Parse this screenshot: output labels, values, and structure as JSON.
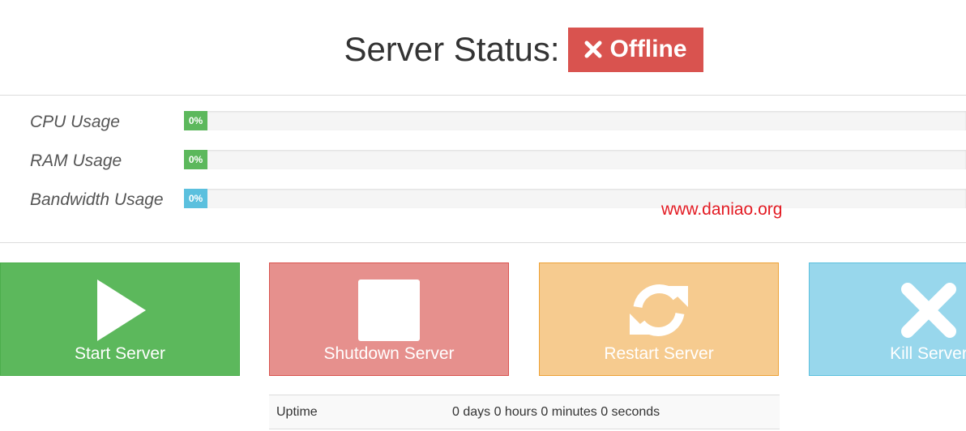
{
  "header": {
    "title": "Server Status:",
    "status_label": "Offline",
    "status_color": "#d9534f",
    "status_icon": "x-icon"
  },
  "usage": [
    {
      "label": "CPU Usage",
      "percent": 0,
      "percent_text": "0%",
      "color": "#5cb85c"
    },
    {
      "label": "RAM Usage",
      "percent": 0,
      "percent_text": "0%",
      "color": "#5cb85c"
    },
    {
      "label": "Bandwidth Usage",
      "percent": 0,
      "percent_text": "0%",
      "color": "#5bc0de"
    }
  ],
  "watermark": "www.daniao.org",
  "actions": [
    {
      "label": "Start Server",
      "icon": "play-icon",
      "color": "#5cb85c"
    },
    {
      "label": "Shutdown Server",
      "icon": "stop-icon",
      "color": "#e6908d"
    },
    {
      "label": "Restart Server",
      "icon": "refresh-icon",
      "color": "#f6cb8f"
    },
    {
      "label": "Kill Server",
      "icon": "close-icon",
      "color": "#98d7ec"
    }
  ],
  "info": {
    "uptime_label": "Uptime",
    "uptime_value": "0 days 0 hours 0 minutes 0 seconds"
  }
}
